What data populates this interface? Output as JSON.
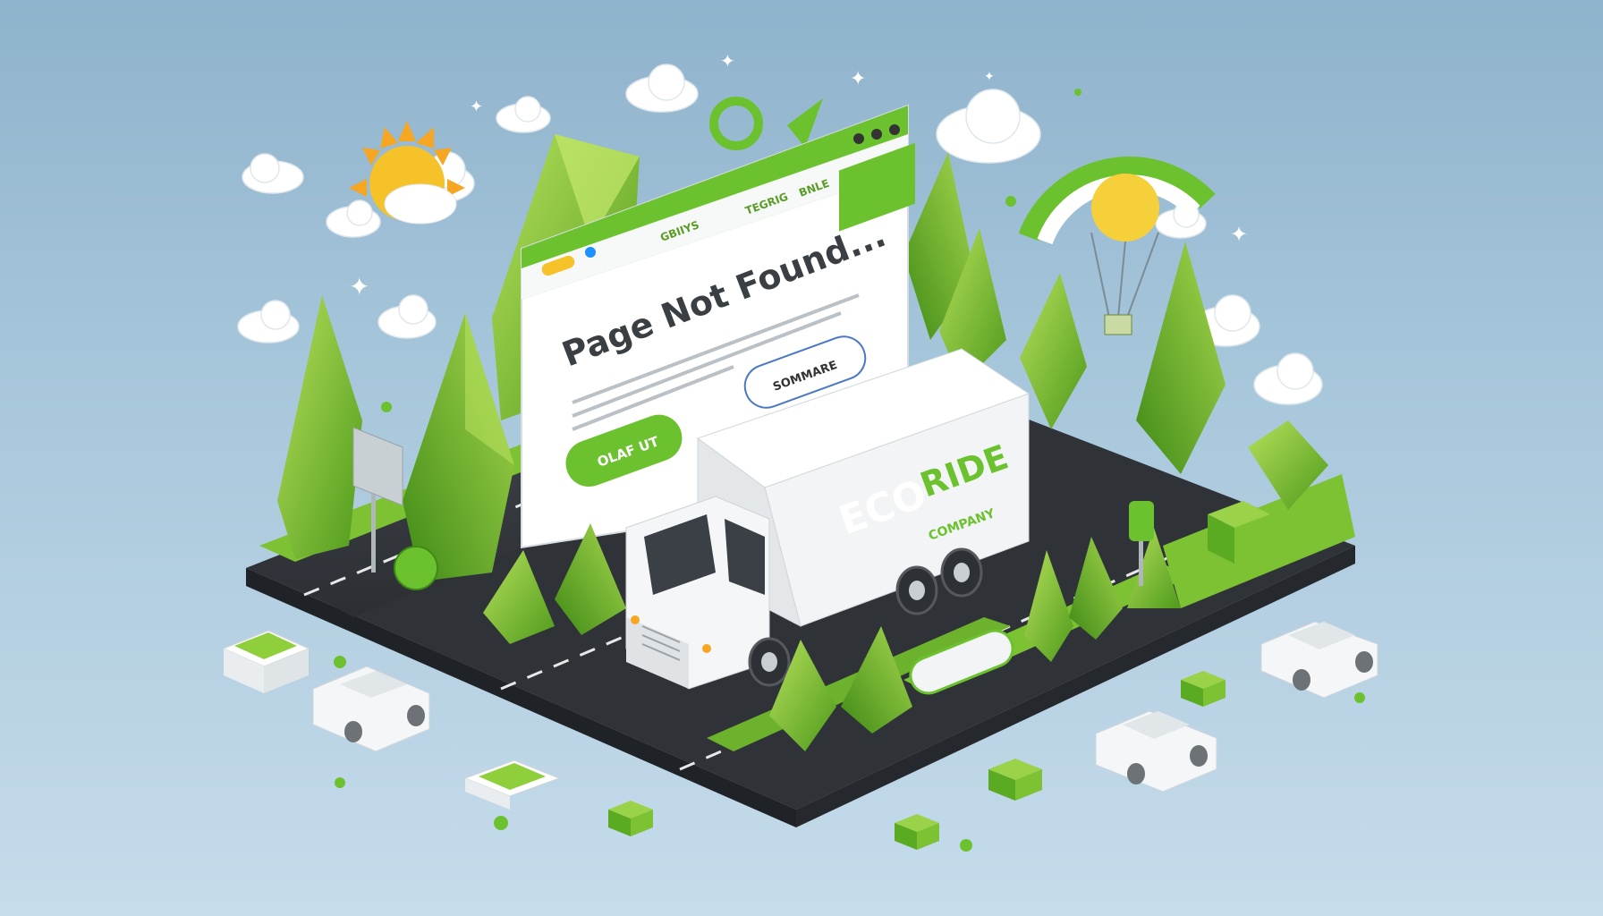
{
  "browser": {
    "nav_items": [
      "GBIIYS",
      "TEGRIG",
      "BNLE"
    ],
    "heading": "Page Not Found...",
    "primary_button_label": "OLAF UT",
    "secondary_button_label": "SOMMARE"
  },
  "truck": {
    "brand_left": "ECO",
    "brand_right": "RIDE",
    "brand_sub": "COMPANY"
  },
  "colors": {
    "brand_green": "#6cc22e",
    "leaf_green": "#8fcf3c",
    "road": "#3a3f45",
    "sky_top": "#8fb3cc",
    "sky_bottom": "#c6dceb",
    "truck_white": "#f2f4f5",
    "sun": "#f5c22a"
  }
}
